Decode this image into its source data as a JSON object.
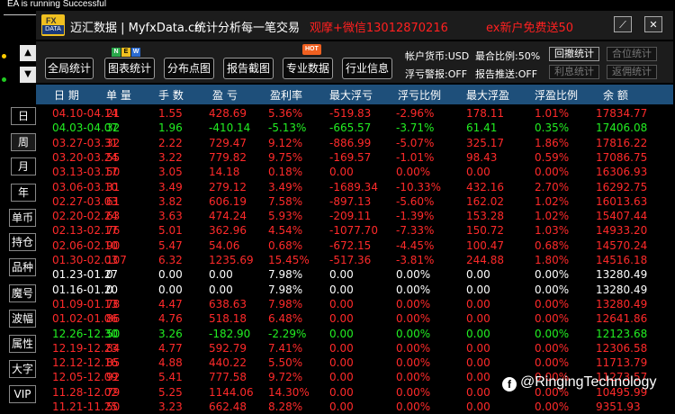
{
  "status_text": "EA is running Successful",
  "header": {
    "logo_top": "FX",
    "logo_bottom": "DATA",
    "brand": "迈汇数据 | MyfxData.cn",
    "slogan": "统计分析每一笔交易",
    "promo_wechat": "观摩+微信13012870216",
    "promo_gift": "ex新户免费送50",
    "edit_glyph": "⟋",
    "close_glyph": "✕"
  },
  "toolbar": {
    "buttons": [
      "全局统计",
      "图表统计",
      "分布点图",
      "报告截图",
      "专业数据",
      "行业信息"
    ],
    "new_badge": [
      "N",
      "E",
      "W"
    ],
    "hot_badge": "HOT",
    "account_currency": "帐户货币:USD",
    "max_ratio": "最合比例:50%",
    "loss_alert": "浮亏警报:OFF",
    "report_push": "报告推送:OFF",
    "right_buttons": [
      "回撤统计",
      "合位统计",
      "利息统计",
      "返佣统计"
    ]
  },
  "nav": {
    "up": "▲",
    "down": "▼",
    "items": [
      "日",
      "周",
      "月",
      "年",
      "单币",
      "持仓",
      "品种",
      "魔号",
      "波幅",
      "属性",
      "大字",
      "VIP"
    ]
  },
  "colors": {
    "red": "#ff2a2a",
    "green": "#22ee22",
    "white": "#ffffff",
    "header_bg": "#1e4f7a"
  },
  "table": {
    "columns": [
      "日 期",
      "单 量",
      "手 数",
      "盈 亏",
      "盈利率",
      "最大浮亏",
      "浮亏比例",
      "最大浮盈",
      "浮盈比例",
      "余 额"
    ],
    "rows": [
      {
        "c": "r",
        "v": [
          "04.10-04.14",
          "21",
          "1.55",
          "428.69",
          "5.36%",
          "-519.83",
          "-2.96%",
          "178.11",
          "1.01%",
          "17834.77"
        ]
      },
      {
        "c": "g",
        "v": [
          "04.03-04.07",
          "32",
          "1.96",
          "-410.14",
          "-5.13%",
          "-665.57",
          "-3.71%",
          "61.41",
          "0.35%",
          "17406.08"
        ]
      },
      {
        "c": "r",
        "v": [
          "03.27-03.31",
          "32",
          "2.22",
          "729.47",
          "9.12%",
          "-886.99",
          "-5.07%",
          "325.17",
          "1.86%",
          "17816.22"
        ]
      },
      {
        "c": "r",
        "v": [
          "03.20-03.24",
          "55",
          "3.22",
          "779.82",
          "9.75%",
          "-169.57",
          "-1.01%",
          "98.43",
          "0.59%",
          "17086.75"
        ]
      },
      {
        "c": "r",
        "v": [
          "03.13-03.17",
          "50",
          "3.05",
          "14.18",
          "0.18%",
          "0.00",
          "0.00%",
          "0.00",
          "0.00%",
          "16306.93"
        ]
      },
      {
        "c": "r",
        "v": [
          "03.06-03.10",
          "31",
          "3.49",
          "279.12",
          "3.49%",
          "-1689.34",
          "-10.33%",
          "432.16",
          "2.70%",
          "16292.75"
        ]
      },
      {
        "c": "r",
        "v": [
          "02.27-03.03",
          "61",
          "3.82",
          "606.19",
          "7.58%",
          "-897.13",
          "-5.60%",
          "162.02",
          "1.02%",
          "16013.63"
        ]
      },
      {
        "c": "r",
        "v": [
          "02.20-02.24",
          "63",
          "3.63",
          "474.24",
          "5.93%",
          "-209.11",
          "-1.39%",
          "153.28",
          "1.02%",
          "15407.44"
        ]
      },
      {
        "c": "r",
        "v": [
          "02.13-02.17",
          "76",
          "5.01",
          "362.96",
          "4.54%",
          "-1077.70",
          "-7.33%",
          "150.72",
          "1.03%",
          "14933.20"
        ]
      },
      {
        "c": "r",
        "v": [
          "02.06-02.10",
          "90",
          "5.47",
          "54.06",
          "0.68%",
          "-672.15",
          "-4.45%",
          "100.47",
          "0.68%",
          "14570.24"
        ]
      },
      {
        "c": "r",
        "v": [
          "01.30-02.03",
          "107",
          "6.32",
          "1235.69",
          "15.45%",
          "-517.36",
          "-3.81%",
          "244.88",
          "1.80%",
          "14516.18"
        ]
      },
      {
        "c": "w",
        "v": [
          "01.23-01.27",
          "0",
          "0.00",
          "0.00",
          "7.98%",
          "0.00",
          "0.00%",
          "0.00",
          "0.00%",
          "13280.49"
        ]
      },
      {
        "c": "w",
        "v": [
          "01.16-01.20",
          "0",
          "0.00",
          "0.00",
          "7.98%",
          "0.00",
          "0.00%",
          "0.00",
          "0.00%",
          "13280.49"
        ]
      },
      {
        "c": "r",
        "v": [
          "01.09-01.13",
          "78",
          "4.47",
          "638.63",
          "7.98%",
          "0.00",
          "0.00%",
          "0.00",
          "0.00%",
          "13280.49"
        ]
      },
      {
        "c": "r",
        "v": [
          "01.02-01.06",
          "86",
          "4.76",
          "518.18",
          "6.48%",
          "0.00",
          "0.00%",
          "0.00",
          "0.00%",
          "12641.86"
        ]
      },
      {
        "c": "g",
        "v": [
          "12.26-12.30",
          "50",
          "3.26",
          "-182.90",
          "-2.29%",
          "0.00",
          "0.00%",
          "0.00",
          "0.00%",
          "12123.68"
        ]
      },
      {
        "c": "r",
        "v": [
          "12.19-12.23",
          "84",
          "4.77",
          "592.79",
          "7.41%",
          "0.00",
          "0.00%",
          "0.00",
          "0.00%",
          "12306.58"
        ]
      },
      {
        "c": "r",
        "v": [
          "12.12-12.16",
          "85",
          "4.88",
          "440.22",
          "5.50%",
          "0.00",
          "0.00%",
          "0.00",
          "0.00%",
          "11713.79"
        ]
      },
      {
        "c": "r",
        "v": [
          "12.05-12.09",
          "92",
          "5.41",
          "777.58",
          "9.72%",
          "0.00",
          "0.00%",
          "0.00",
          "0.00%",
          "11273.57"
        ]
      },
      {
        "c": "r",
        "v": [
          "11.28-12.02",
          "79",
          "5.25",
          "1144.06",
          "14.30%",
          "0.00",
          "0.00%",
          "0.00",
          "0.00%",
          "10495.99"
        ]
      },
      {
        "c": "r",
        "v": [
          "11.21-11.25",
          "50",
          "3.23",
          "662.48",
          "8.28%",
          "0.00",
          "0.00%",
          "0.00",
          "0.00%",
          "9351.93"
        ]
      }
    ]
  },
  "watermark": {
    "icon": "f",
    "text": "@RingingTechnology"
  }
}
